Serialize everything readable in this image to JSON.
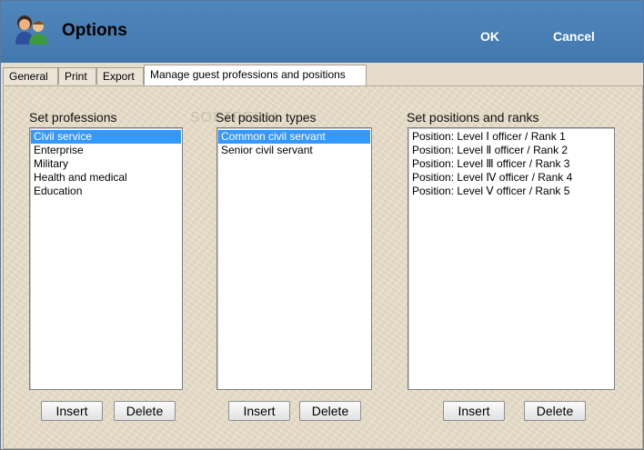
{
  "window": {
    "title": "Options"
  },
  "header": {
    "ok_label": "OK",
    "cancel_label": "Cancel"
  },
  "tabs": [
    {
      "label": "General"
    },
    {
      "label": "Print"
    },
    {
      "label": "Export"
    },
    {
      "label": "Manage guest professions and positions"
    }
  ],
  "watermark": "SOFTPEDIA",
  "professions": {
    "label": "Set professions",
    "items": [
      "Civil service",
      "Enterprise",
      "Military",
      "Health and medical",
      "Education"
    ],
    "selected": "Civil service",
    "insert_label": "Insert",
    "delete_label": "Delete"
  },
  "position_types": {
    "label": "Set position types",
    "items": [
      "Common civil servant",
      "Senior civil servant"
    ],
    "selected": "Common civil servant",
    "insert_label": "Insert",
    "delete_label": "Delete"
  },
  "positions": {
    "label": "Set positions and ranks",
    "items": [
      "Position: Level Ⅰ officer / Rank 1",
      "Position: Level Ⅱ officer / Rank 2",
      "Position: Level Ⅲ officer / Rank 3",
      "Position: Level Ⅳ officer / Rank 4",
      "Position: Level Ⅴ officer / Rank 5"
    ],
    "insert_label": "Insert",
    "delete_label": "Delete"
  },
  "colors": {
    "header": "#4a80b4",
    "selection": "#3399ff",
    "panel": "#e7ddc9"
  }
}
